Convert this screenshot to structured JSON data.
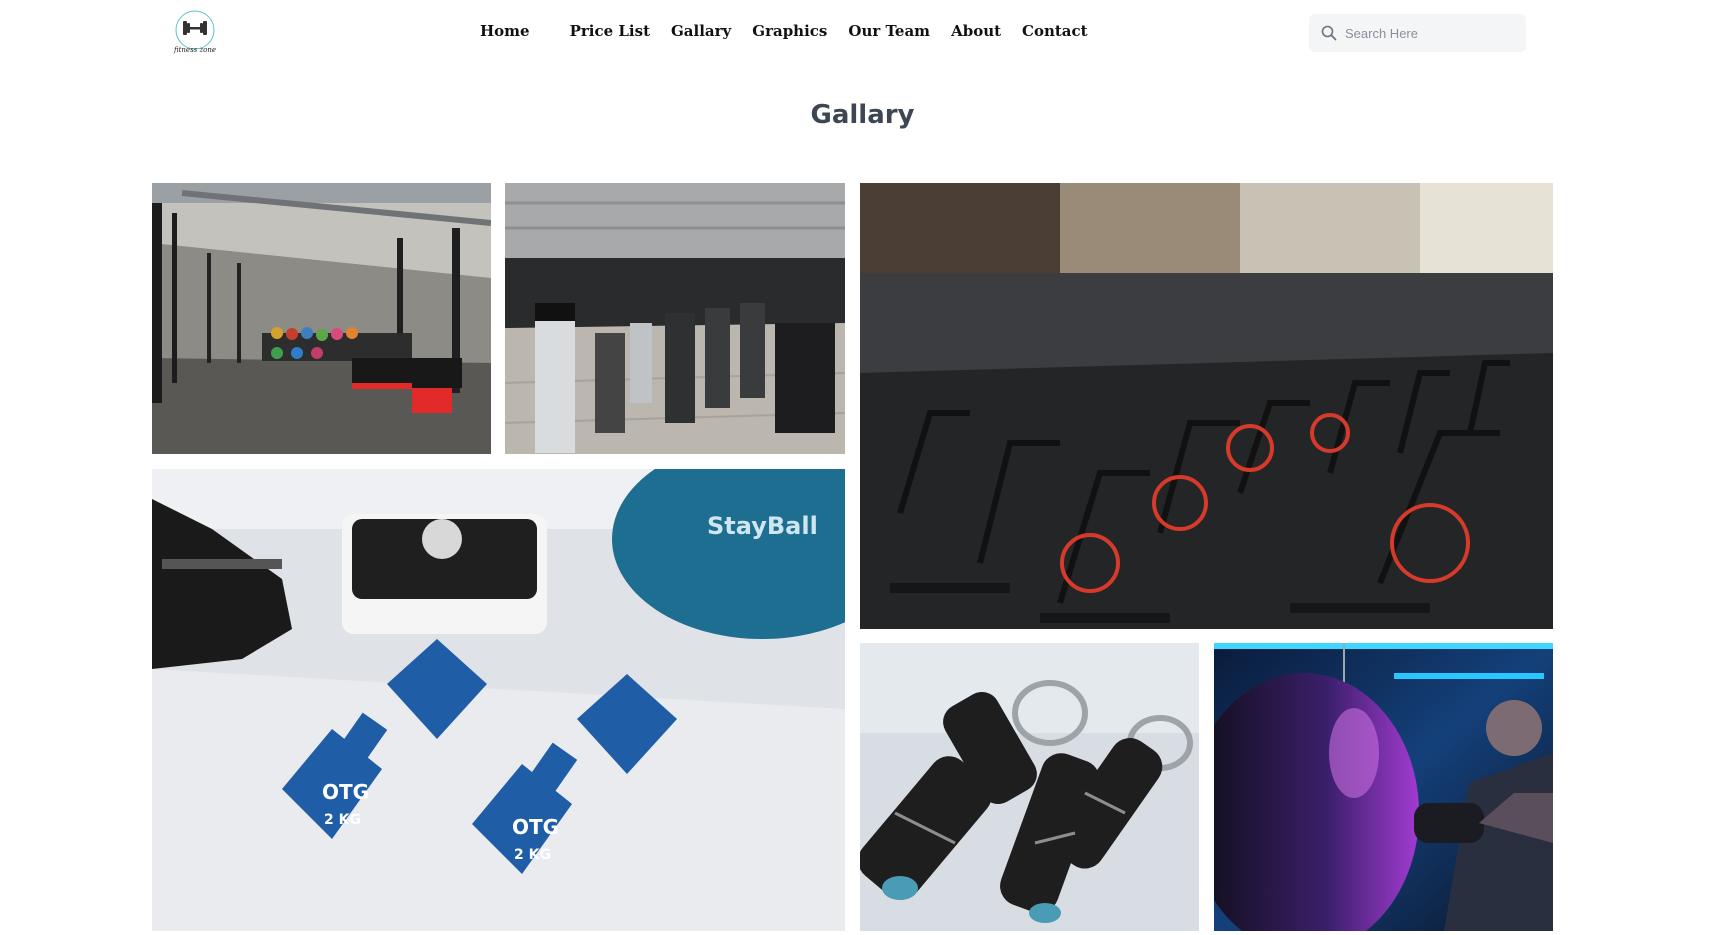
{
  "logo": {
    "text": "fitness zone",
    "icon": "dumbbell-icon"
  },
  "nav": {
    "items": [
      {
        "label": "Home"
      },
      {
        "label": "Price List"
      },
      {
        "label": "Gallary"
      },
      {
        "label": "Graphics"
      },
      {
        "label": "Our Team"
      },
      {
        "label": "About"
      },
      {
        "label": "Contact"
      }
    ]
  },
  "search": {
    "placeholder": "Search Here",
    "icon": "search-icon"
  },
  "page_title": "Gallary",
  "gallery": {
    "images": [
      {
        "subject": "gym floor with weight racks and kettlebells"
      },
      {
        "subject": "cardio machines on wood floor"
      },
      {
        "subject": "spinning bikes studio"
      },
      {
        "subject": "blue 2KG dumbbells, scale and stability ball"
      },
      {
        "subject": "hand grip exercisers"
      },
      {
        "subject": "boxer with punching bag under neon light"
      }
    ],
    "dumbbell_label": "2 KG",
    "dumbbell_brand": "OTG",
    "ball_label": "StayBall"
  },
  "colors": {
    "title": "#3d4652",
    "nav_text": "#111111",
    "search_bg": "#f4f5f7",
    "logo_ring": "#5bc3c9"
  }
}
